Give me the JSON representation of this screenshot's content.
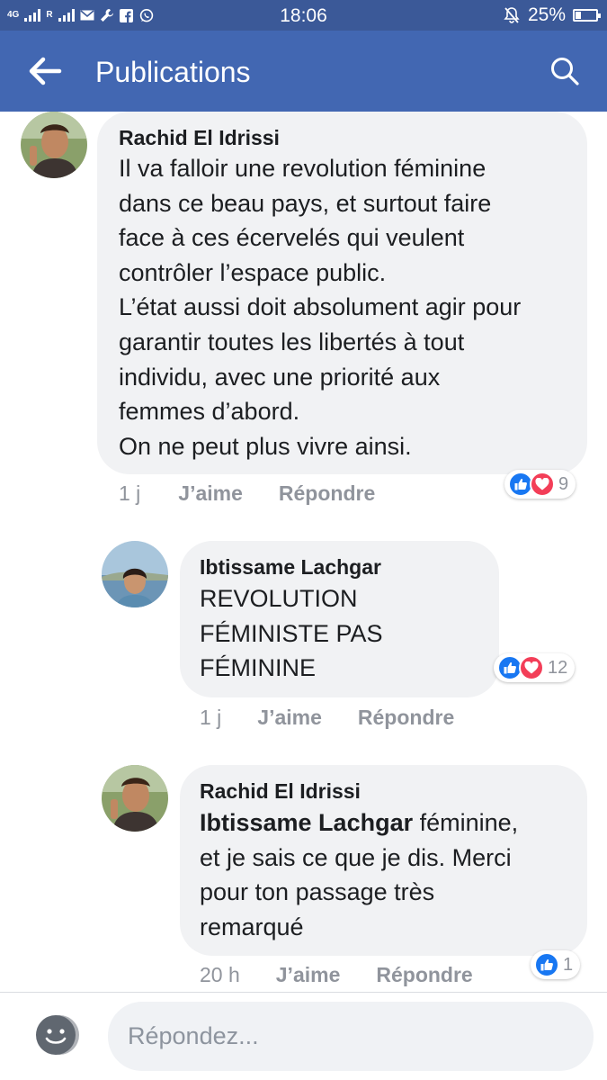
{
  "status_bar": {
    "network": "4G",
    "carrier_small": "R",
    "time": "18:06",
    "battery": "25%",
    "battery_level": 0.25,
    "icons": [
      "signal-icon",
      "mail-icon",
      "wrench-icon",
      "facebook-icon",
      "whatsapp-icon",
      "mute-icon",
      "battery-icon"
    ]
  },
  "header": {
    "title": "Publications",
    "back_icon": "arrow-left-icon",
    "search_icon": "search-icon"
  },
  "comments": [
    {
      "author": "Rachid El Idrissi",
      "lines": [
        "Il va falloir une revolution féminine",
        "dans ce beau pays, et surtout faire",
        "face à ces écervelés qui veulent",
        "contrôler l’espace public.",
        "L’état aussi doit absolument agir pour",
        "garantir toutes les libertés à tout",
        "individu, avec une priorité aux",
        "femmes d’abord.",
        "On ne peut plus vivre ainsi."
      ],
      "time": "1 j",
      "like": "J’aime",
      "reply": "Répondre",
      "reactions": [
        "like",
        "love"
      ],
      "reaction_count": "9"
    },
    {
      "author": "Ibtissame Lachgar",
      "lines": [
        "REVOLUTION",
        "FÉMINISTE PAS",
        "FÉMININE"
      ],
      "time": "1 j",
      "like": "J’aime",
      "reply": "Répondre",
      "reactions": [
        "like",
        "love"
      ],
      "reaction_count": "12"
    },
    {
      "author": "Rachid El Idrissi",
      "mention": "Ibtissame Lachgar",
      "first_line_rest": " féminine,",
      "lines": [
        "et je sais ce que je dis. Merci",
        "pour ton passage très",
        "remarqué"
      ],
      "time": "20 h",
      "like": "J’aime",
      "reply": "Répondre",
      "reactions": [
        "like"
      ],
      "reaction_count": "1"
    }
  ],
  "composer": {
    "placeholder": "Répondez...",
    "emoji_icon": "sticker-icon"
  },
  "colors": {
    "status_bar": "#3b5998",
    "app_bar": "#4267b2",
    "bubble": "#f1f2f4",
    "like": "#1877f2",
    "love": "#f33e58",
    "meta": "#90949c"
  }
}
